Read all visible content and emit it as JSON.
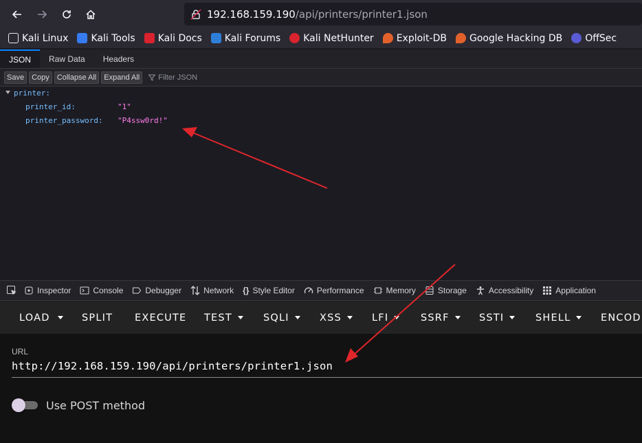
{
  "browser": {
    "url_host": "192.168.159.190",
    "url_path": "/api/printers/printer1.json"
  },
  "bookmarks": [
    {
      "label": "Kali Linux",
      "color": "#e8e8e8"
    },
    {
      "label": "Kali Tools",
      "color": "#367bf0"
    },
    {
      "label": "Kali Docs",
      "color": "#d9232e"
    },
    {
      "label": "Kali Forums",
      "color": "#2d7fd8"
    },
    {
      "label": "Kali NetHunter",
      "color": "#d9232e"
    },
    {
      "label": "Exploit-DB",
      "color": "#e2612b"
    },
    {
      "label": "Google Hacking DB",
      "color": "#e2612b"
    },
    {
      "label": "OffSec",
      "color": "#5b5bd6"
    }
  ],
  "json_viewer": {
    "tabs": [
      "JSON",
      "Raw Data",
      "Headers"
    ],
    "buttons": [
      "Save",
      "Copy",
      "Collapse All",
      "Expand All"
    ],
    "filter_placeholder": "Filter JSON",
    "root_key": "printer:",
    "rows": [
      {
        "key": "printer_id:",
        "value": "\"1\""
      },
      {
        "key": "printer_password:",
        "value": "\"P4ssw0rd!\""
      }
    ]
  },
  "devtools": {
    "tabs": [
      "Inspector",
      "Console",
      "Debugger",
      "Network",
      "Style Editor",
      "Performance",
      "Memory",
      "Storage",
      "Accessibility",
      "Application"
    ]
  },
  "hackbar": {
    "menu": [
      {
        "label": "LOAD",
        "caret": false
      },
      {
        "label": "SPLIT",
        "caret": false
      },
      {
        "label": "EXECUTE",
        "caret": false
      },
      {
        "label": "TEST",
        "caret": true
      },
      {
        "label": "SQLI",
        "caret": true
      },
      {
        "label": "XSS",
        "caret": true
      },
      {
        "label": "LFI",
        "caret": true
      },
      {
        "label": "SSRF",
        "caret": true
      },
      {
        "label": "SSTI",
        "caret": true
      },
      {
        "label": "SHELL",
        "caret": true
      },
      {
        "label": "ENCODING",
        "caret": false
      }
    ],
    "url_label": "URL",
    "url_value": "http://192.168.159.190/api/printers/printer1.json",
    "post_label": "Use POST method"
  },
  "colors": {
    "annotation_arrow": "#e0262b",
    "json_key": "#75bfff",
    "json_string": "#ff7de9"
  }
}
